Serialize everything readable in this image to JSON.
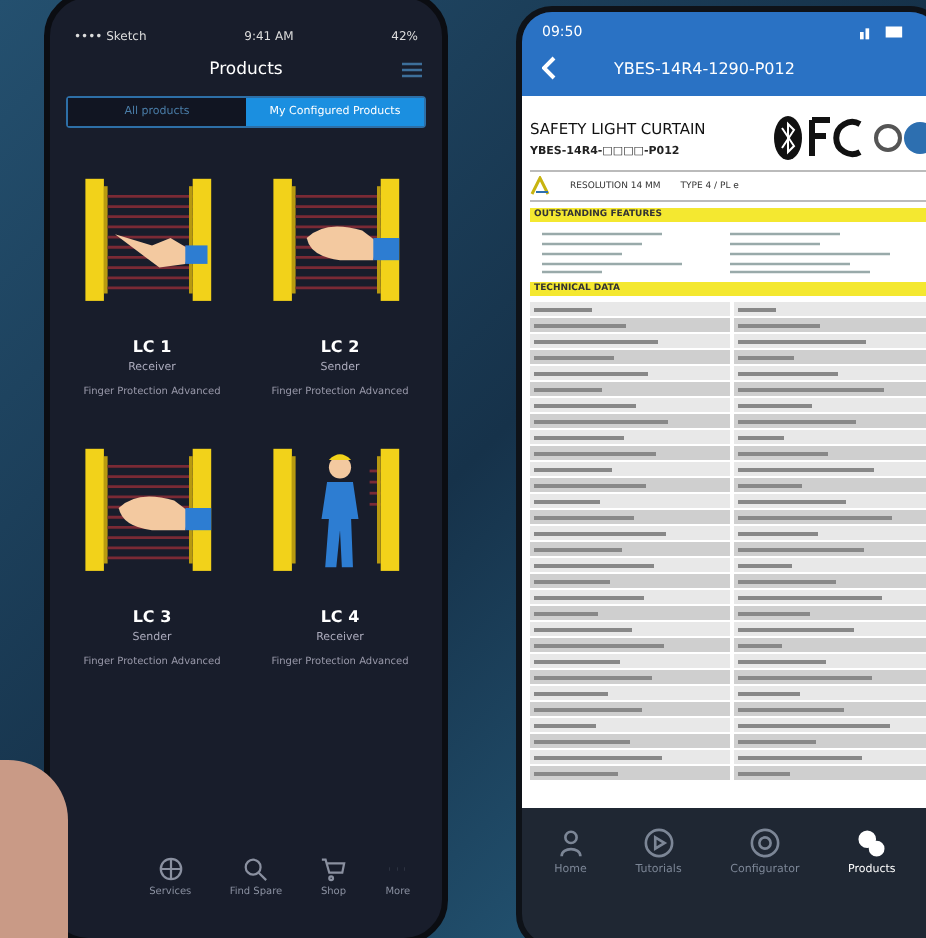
{
  "left_phone": {
    "status_bar": {
      "carrier": "•••• Sketch",
      "time": "9:41 AM",
      "battery": "42%"
    },
    "title": "Products",
    "segments": [
      {
        "label": "All products",
        "selected": false
      },
      {
        "label": "My Configured Products",
        "selected": true
      }
    ],
    "products": [
      {
        "name": "LC 1",
        "role": "Receiver",
        "description": "Finger Protection Advanced",
        "kind": "finger"
      },
      {
        "name": "LC 2",
        "role": "Sender",
        "description": "Finger Protection Advanced",
        "kind": "hand"
      },
      {
        "name": "LC 3",
        "role": "Sender",
        "description": "Finger Protection Advanced",
        "kind": "hand"
      },
      {
        "name": "LC 4",
        "role": "Receiver",
        "description": "Finger Protection Advanced",
        "kind": "person"
      }
    ],
    "tab_bar": [
      {
        "label": "Services",
        "selected": false
      },
      {
        "label": "Find Spare",
        "selected": false
      },
      {
        "label": "Shop",
        "selected": false
      },
      {
        "label": "More",
        "selected": false
      }
    ]
  },
  "right_phone": {
    "status_bar": {
      "time": "09:50"
    },
    "title": "YBES-14R4-1290-P012",
    "datasheet": {
      "heading": "SAFETY LIGHT CURTAIN",
      "model": "YBES-14R4-□□□□-P012",
      "resolution": "RESOLUTION 14 MM",
      "type": "TYPE 4 / PL e",
      "features_heading": "OUTSTANDING FEATURES",
      "technical_heading": "TECHNICAL DATA"
    },
    "tab_bar": [
      {
        "label": "Home",
        "selected": false
      },
      {
        "label": "Tutorials",
        "selected": false
      },
      {
        "label": "Configurator",
        "selected": false
      },
      {
        "label": "Products",
        "selected": true
      }
    ]
  }
}
